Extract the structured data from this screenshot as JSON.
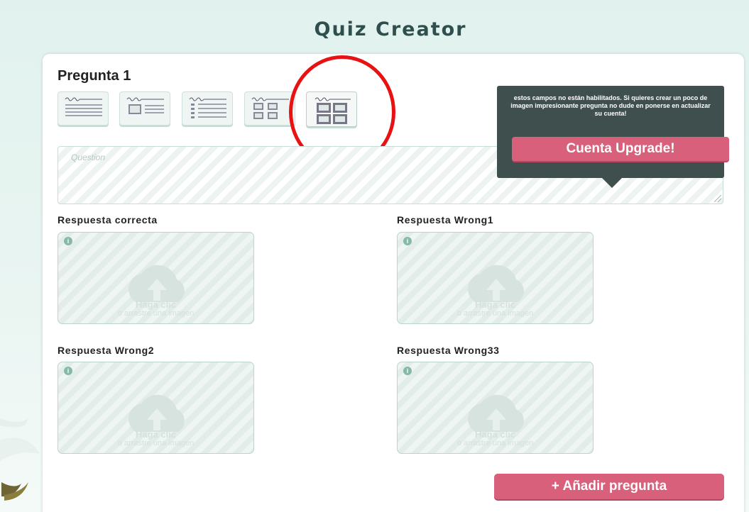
{
  "app": {
    "title": "Quiz Creator"
  },
  "question": {
    "title": "Pregunta 1",
    "placeholder": "Question"
  },
  "question_types": [
    {
      "name": "text-only",
      "active": false
    },
    {
      "name": "image-and-text",
      "active": false
    },
    {
      "name": "list-answers",
      "active": false
    },
    {
      "name": "image-answers-small",
      "active": false
    },
    {
      "name": "image-answers-grid",
      "active": true
    }
  ],
  "tooltip": {
    "message": "estos campos no están habilitados. Si quieres crear un poco de imagen impresionante pregunta no dude en ponerse en actualizar su cuenta!",
    "upgrade_label": "Cuenta Upgrade!"
  },
  "answers": [
    {
      "label": "Respuesta correcta",
      "upload_title": "Haga clic",
      "upload_sub": "o arrastre una imagen"
    },
    {
      "label": "Respuesta Wrong1",
      "upload_title": "Haga clic",
      "upload_sub": "o arrastre una imagen"
    },
    {
      "label": "Respuesta Wrong2",
      "upload_title": "Haga clic",
      "upload_sub": "o arrastre una imagen"
    },
    {
      "label": "Respuesta Wrong33",
      "upload_title": "Haga clic",
      "upload_sub": "o arrastre una imagen"
    }
  ],
  "add_question_label": "+ Añadir pregunta",
  "colors": {
    "accent": "#d9607b",
    "tooltip_bg": "#3e4f4e",
    "highlight": "#e81212"
  }
}
